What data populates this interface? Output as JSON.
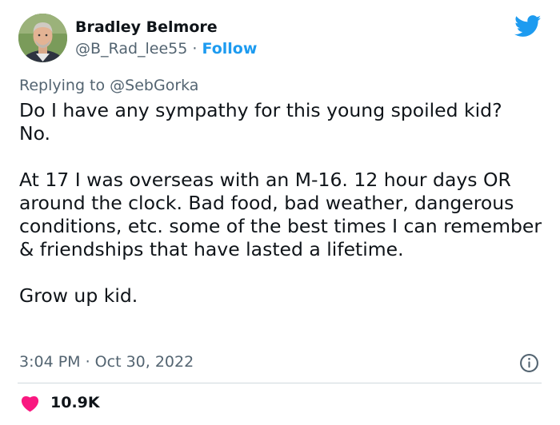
{
  "author": {
    "name": "Bradley Belmore",
    "handle": "@B_Rad_lee55",
    "separator": "·",
    "follow_label": "Follow"
  },
  "reply_context": {
    "prefix": "Replying to ",
    "mention": "@SebGorka"
  },
  "tweet": {
    "paragraphs": [
      "Do I have any sympathy for this young spoiled kid?\nNo.",
      "At 17 I was overseas with an M-16. 12 hour days OR around the clock. Bad food, bad weather, dangerous conditions, etc. some of the best times I can remember & friendships that have lasted a lifetime.",
      "Grow up kid."
    ],
    "timestamp": "3:04 PM · Oct 30, 2022"
  },
  "engagement": {
    "likes": "10.9K"
  },
  "icons": {
    "brand": "twitter-bird-icon",
    "info": "info-icon",
    "like": "heart-icon"
  },
  "colors": {
    "brand": "#1d9bf0",
    "like": "#f91880",
    "secondary_text": "#536471",
    "primary_text": "#0f1419",
    "divider": "#cfd9de"
  }
}
